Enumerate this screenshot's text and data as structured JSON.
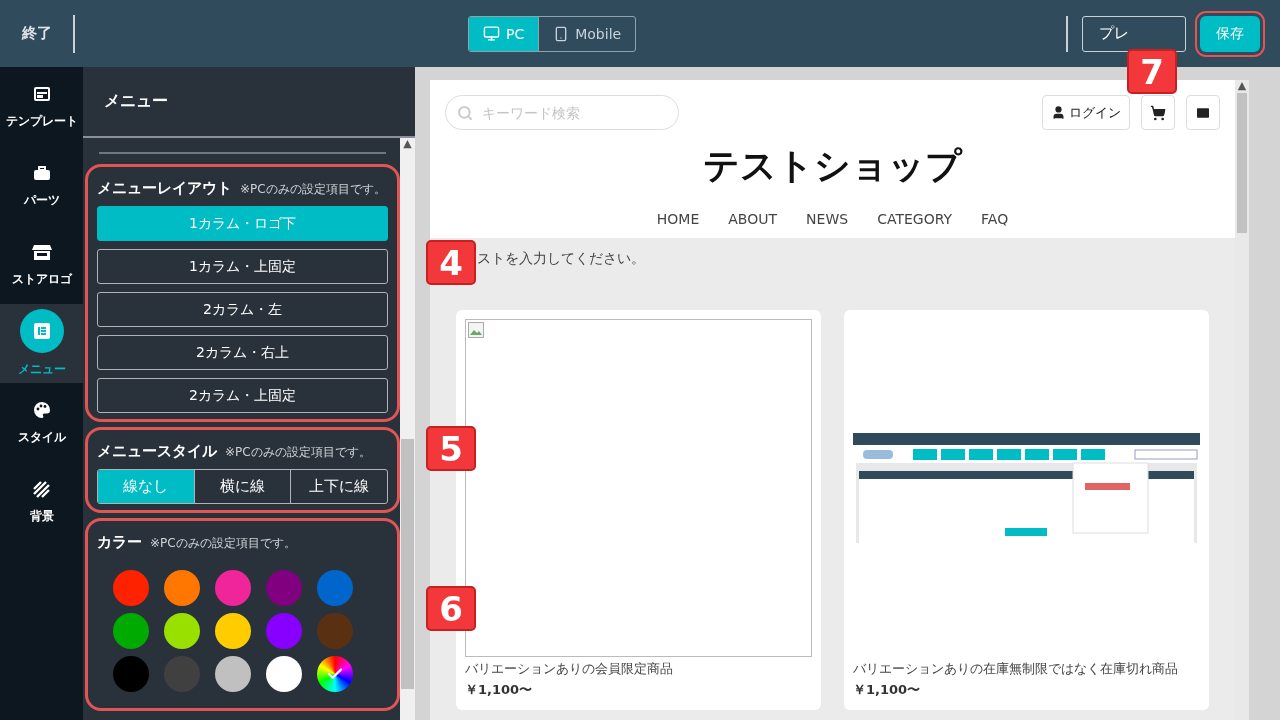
{
  "toolbar": {
    "exit": "終了",
    "devices": [
      {
        "kind": "pc",
        "label": "PC",
        "selected": true
      },
      {
        "kind": "mobile",
        "label": "Mobile",
        "selected": false
      }
    ],
    "preview": "プレ",
    "save": "保存"
  },
  "sidebar": {
    "items": [
      {
        "kind": "template",
        "label": "テンプレート",
        "selected": false
      },
      {
        "kind": "parts",
        "label": "パーツ",
        "selected": false
      },
      {
        "kind": "store",
        "label": "ストアロゴ",
        "selected": false
      },
      {
        "kind": "menu",
        "label": "メニュー",
        "selected": true
      },
      {
        "kind": "style",
        "label": "スタイル",
        "selected": false
      },
      {
        "kind": "background",
        "label": "背景",
        "selected": false
      }
    ]
  },
  "panel": {
    "title": "メニュー",
    "layout": {
      "title": "メニューレイアウト",
      "note": "※PCのみの設定項目です。",
      "outlined": true,
      "options": [
        {
          "label": "1カラム・ロゴ下",
          "selected": true
        },
        {
          "label": "1カラム・上固定",
          "selected": false
        },
        {
          "label": "2カラム・左",
          "selected": false
        },
        {
          "label": "2カラム・右上",
          "selected": false
        },
        {
          "label": "2カラム・上固定",
          "selected": false
        }
      ]
    },
    "style": {
      "title": "メニュースタイル",
      "note": "※PCのみの設定項目です。",
      "outlined": true,
      "options": [
        {
          "label": "線なし",
          "selected": true
        },
        {
          "label": "横に線",
          "selected": false
        },
        {
          "label": "上下に線",
          "selected": false
        }
      ]
    },
    "color": {
      "title": "カラー",
      "note": "※PCのみの設定項目です。",
      "outlined": true,
      "swatches": [
        {
          "kind": "solid",
          "color": "#ff2200",
          "selected": false
        },
        {
          "kind": "solid",
          "color": "#ff7700",
          "selected": false
        },
        {
          "kind": "solid",
          "color": "#f0259a",
          "selected": false
        },
        {
          "kind": "solid",
          "color": "#800080",
          "selected": false
        },
        {
          "kind": "solid",
          "color": "#0066cc",
          "selected": false
        },
        {
          "kind": "solid",
          "color": "#00aa00",
          "selected": false
        },
        {
          "kind": "solid",
          "color": "#99e000",
          "selected": false
        },
        {
          "kind": "solid",
          "color": "#ffcc00",
          "selected": false
        },
        {
          "kind": "solid",
          "color": "#8800ff",
          "selected": false
        },
        {
          "kind": "solid",
          "color": "#5a3012",
          "selected": false
        },
        {
          "kind": "solid",
          "color": "#000000",
          "selected": false
        },
        {
          "kind": "solid",
          "color": "#404040",
          "selected": false
        },
        {
          "kind": "solid",
          "color": "#c0c0c0",
          "selected": false
        },
        {
          "kind": "solid",
          "color": "#ffffff",
          "selected": false
        },
        {
          "kind": "custom",
          "selected": true
        }
      ]
    }
  },
  "preview": {
    "search_placeholder": "キーワード検索",
    "login": "ログイン",
    "shop_name": "テストショップ",
    "nav": [
      "HOME",
      "ABOUT",
      "NEWS",
      "CATEGORY",
      "FAQ"
    ],
    "intro": "ストを入力してください。",
    "products": [
      {
        "kind": "broken-image",
        "name": "バリエーションありの会員限定商品",
        "price": "￥1,100〜"
      },
      {
        "kind": "picture",
        "name": "バリエーションありの在庫無制限ではなく在庫切れ商品",
        "price": "￥1,100〜"
      }
    ]
  },
  "scroll_arrows": [
    "▲",
    "▲"
  ],
  "callouts": [
    "4",
    "5",
    "6",
    "7"
  ]
}
